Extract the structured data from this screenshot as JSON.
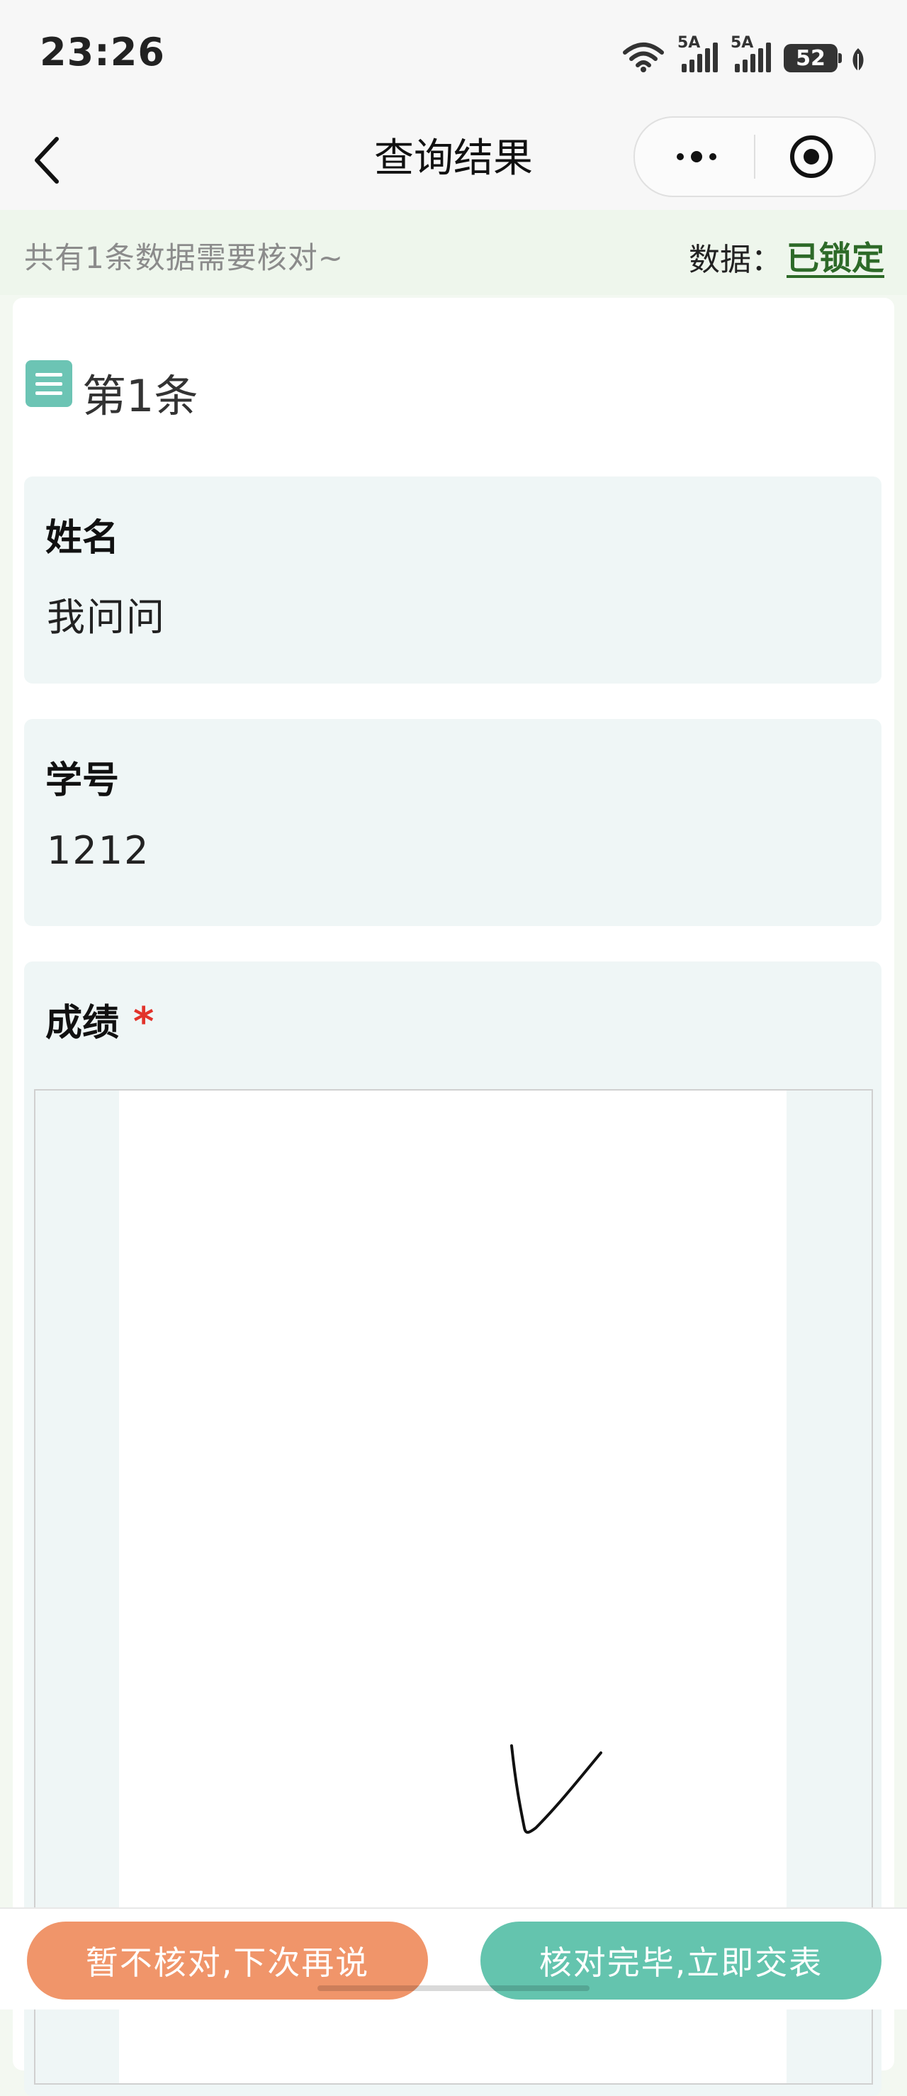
{
  "status_bar": {
    "time": "23:26",
    "signal1_label": "5A",
    "signal2_label": "5A",
    "battery": "52"
  },
  "navbar": {
    "title": "查询结果"
  },
  "info": {
    "summary": "共有1条数据需要核对~",
    "data_label": "数据：",
    "lock_status": "已锁定"
  },
  "record": {
    "title": "第1条",
    "fields": {
      "name": {
        "label": "姓名",
        "value": "我问问"
      },
      "student_id": {
        "label": "学号",
        "value": "1212"
      },
      "score": {
        "label": "成绩",
        "required_mark": "*"
      }
    }
  },
  "actions": {
    "later_label": "暂不核对,下次再说",
    "submit_label": "核对完毕,立即交表"
  },
  "colors": {
    "accent_green": "#2d6a28",
    "later_button": "#f0956a",
    "submit_button": "#64c4ae",
    "field_bg": "#eff6f6",
    "required": "#e2332b"
  },
  "icons": [
    "wifi-icon",
    "signal-icon",
    "battery-icon",
    "back-icon",
    "more-icon",
    "target-icon",
    "list-icon"
  ]
}
